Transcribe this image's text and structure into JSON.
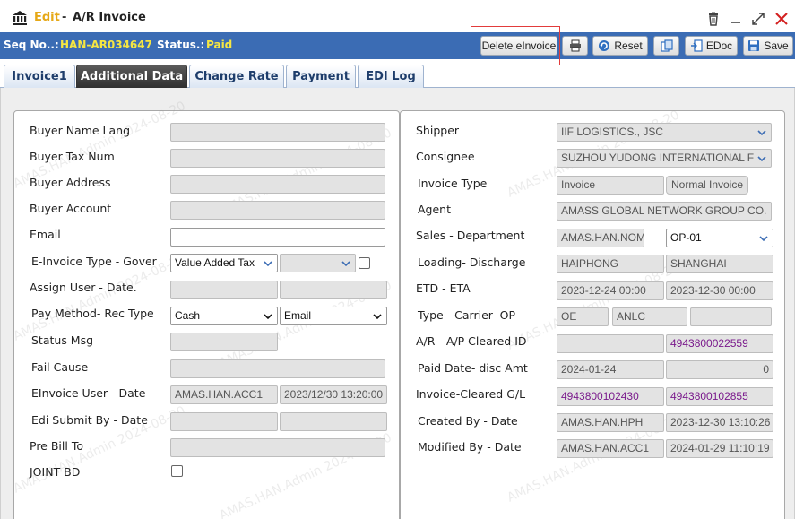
{
  "title": {
    "mode": "Edit",
    "separator": "-",
    "name": "A/R Invoice"
  },
  "status_bar": {
    "seq_label": "Seq No..:",
    "seq_value": "HAN-AR034647",
    "status_label": "Status.:",
    "status_value": "Paid"
  },
  "toolbar": {
    "delete_einvoice": "Delete eInvoice",
    "reset": "Reset",
    "edoc": "EDoc",
    "save": "Save"
  },
  "tabs": [
    "Invoice1",
    "Additional Data",
    "Change Rate",
    "Payment",
    "EDI Log"
  ],
  "watermark": "AMAS.HAN.Admin 2024-08-20",
  "left": {
    "buyer_name_lang": {
      "label": "Buyer Name Lang",
      "value": ""
    },
    "buyer_tax_num": {
      "label": "Buyer Tax Num",
      "value": ""
    },
    "buyer_address": {
      "label": "Buyer Address",
      "value": ""
    },
    "buyer_account": {
      "label": "Buyer Account",
      "value": ""
    },
    "email": {
      "label": "Email",
      "value": ""
    },
    "einvoice_type": {
      "label": "E-Invoice Type -  Gover",
      "value": "Value Added Tax",
      "gov_value": ""
    },
    "assign_user": {
      "label": "Assign User - Date.",
      "user": "",
      "date": ""
    },
    "pay_method": {
      "label": "Pay Method-  Rec Type",
      "method": "Cash",
      "rec_type": "Email"
    },
    "status_msg": {
      "label": "Status Msg",
      "value": ""
    },
    "fail_cause": {
      "label": "Fail Cause",
      "value": ""
    },
    "einvoice_user": {
      "label": "EInvoice User -  Date",
      "user": "AMAS.HAN.ACC1",
      "date": "2023/12/30 13:20:00"
    },
    "edi_submit": {
      "label": "Edi Submit By -  Date",
      "user": "",
      "date": ""
    },
    "pre_bill_to": {
      "label": "Pre Bill To",
      "value": ""
    },
    "joint_bd": {
      "label": "JOINT BD"
    }
  },
  "right": {
    "shipper": {
      "label": "Shipper",
      "value": "IIF LOGISTICS., JSC"
    },
    "consignee": {
      "label": "Consignee",
      "value": "SUZHOU YUDONG INTERNATIONAL F"
    },
    "invoice_type": {
      "label": "Invoice Type",
      "value": "Invoice",
      "sub": "Normal Invoice"
    },
    "agent": {
      "label": "Agent",
      "value": "AMASS GLOBAL NETWORK GROUP CO."
    },
    "sales_department": {
      "label": "Sales - Department",
      "sales": "AMAS.HAN.NOM",
      "dept": "OP-01"
    },
    "loading_discharge": {
      "label": "Loading- Discharge",
      "loading": "HAIPHONG",
      "discharge": "SHANGHAI"
    },
    "etd_eta": {
      "label": "ETD - ETA",
      "etd": "2023-12-24 00:00",
      "eta": "2023-12-30 00:00"
    },
    "type_carrier_op": {
      "label": "Type -  Carrier-  OP",
      "type": "OE",
      "carrier": "ANLC",
      "op": ""
    },
    "cleared_id": {
      "label": "A/R - A/P Cleared ID",
      "ar": "",
      "ap": "4943800022559"
    },
    "paid_date": {
      "label": "Paid Date- disc Amt",
      "date": "2024-01-24",
      "amt": "0"
    },
    "cleared_gl": {
      "label": "Invoice-Cleared G/L",
      "invoice": "4943800102430",
      "gl": "4943800102855"
    },
    "created_by": {
      "label": "Created By -  Date",
      "user": "AMAS.HAN.HPH",
      "date": "2023-12-30 13:10:26"
    },
    "modified_by": {
      "label": "Modified By -  Date",
      "user": "AMAS.HAN.ACC1",
      "date": "2024-01-29 11:10:19"
    }
  }
}
